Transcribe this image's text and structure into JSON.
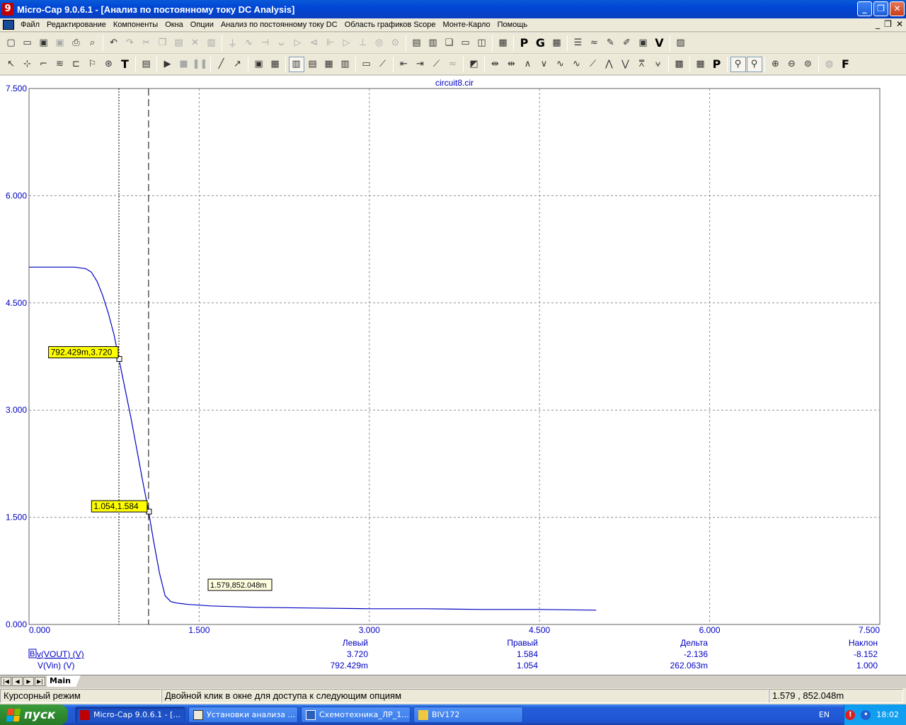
{
  "window": {
    "title": "Micro-Cap 9.0.6.1 - [Анализ по постоянному току DC Analysis]",
    "app_icon_glyph": "9",
    "controls": [
      "_",
      "❐",
      "✕"
    ]
  },
  "menu": {
    "items": [
      "Файл",
      "Редактирование",
      "Компоненты",
      "Окна",
      "Опции",
      "Анализ по постоянному току DC",
      "Область графиков Scope",
      "Монте-Карло",
      "Помощь"
    ],
    "mdi_controls": [
      "_",
      "❐",
      "✕"
    ]
  },
  "toolbar1": [
    "new-icon",
    "open-icon",
    "save-icon",
    "save-all-icon",
    "print-icon",
    "print-preview-icon",
    "sep",
    "undo-icon",
    "redo-icon",
    "cut-icon",
    "copy-icon",
    "paste-icon",
    "delete-icon",
    "select-all-icon",
    "sep",
    "ground-icon",
    "resistor-icon",
    "capacitor-icon",
    "inductor-icon",
    "diode-icon",
    "bjt-icon",
    "mosfet-icon",
    "opamp-icon",
    "battery-icon",
    "source-icon",
    "sine-source-icon",
    "sep",
    "tile-horizontal-icon",
    "tile-vertical-icon",
    "cascade-icon",
    "window-icon",
    "split-icon",
    "sep",
    "calculator-icon",
    "sep",
    "p-icon",
    "g-icon",
    "grid-icon",
    "sep",
    "list-icon",
    "wave-icon",
    "probe-icon",
    "pen-icon",
    "scope-icon",
    "vd-icon",
    "sep",
    "picture-icon"
  ],
  "toolbar2": [
    "select-arrow-icon",
    "component-icon",
    "wire-icon",
    "bus-icon",
    "node-icon",
    "flag-icon",
    "point-icon",
    "text-icon",
    "sep",
    "properties-icon",
    "sep",
    "run-icon",
    "stop-icon",
    "pause-icon",
    "sep",
    "line-icon",
    "diagonal-icon",
    "sep",
    "box-icon",
    "table-icon",
    "sep",
    "grid1-icon",
    "grid2-icon",
    "grid3-icon",
    "grid4-icon",
    "sep",
    "scale-icon",
    "tangent-icon",
    "sep",
    "peak-left-icon",
    "peak-right-icon",
    "slope-icon",
    "flat-icon",
    "sep",
    "chart-icon",
    "sep",
    "cursor-left-icon",
    "cursor-right-icon",
    "peak-icon",
    "valley-icon",
    "high-icon",
    "low-icon",
    "inflection-icon",
    "global-high-icon",
    "global-low-icon",
    "top-icon",
    "bottom-icon",
    "sep",
    "package-icon",
    "sep",
    "numeric-icon",
    "p-tag-icon",
    "sep",
    "cursor-mode-icon",
    "cursor-mode2-icon",
    "sep",
    "zoom-in-icon",
    "zoom-out-icon",
    "zoom-fit-icon",
    "sep",
    "stepping-icon",
    "f-icon"
  ],
  "plot": {
    "file_title": "circuit8.cir",
    "callouts": {
      "left_cursor": "792.429m,3.720",
      "right_cursor": "1.054,1.584",
      "mouse": "1.579,852.048m"
    }
  },
  "chart_data": {
    "type": "line",
    "title": "circuit8.cir",
    "xlim": [
      0,
      7.5
    ],
    "ylim": [
      0,
      7.5
    ],
    "x_ticks": [
      "0.000",
      "1.500",
      "3.000",
      "4.500",
      "6.000",
      "7.500"
    ],
    "y_ticks": [
      "0.000",
      "1.500",
      "3.000",
      "4.500",
      "6.000",
      "7.500"
    ],
    "grid": true,
    "series": [
      {
        "name": "v(VOUT) (V)",
        "color": "#0000c0",
        "x": [
          0,
          0.2,
          0.4,
          0.5,
          0.55,
          0.6,
          0.65,
          0.7,
          0.75,
          0.792,
          0.85,
          0.9,
          0.95,
          1.0,
          1.054,
          1.1,
          1.15,
          1.2,
          1.25,
          1.3,
          1.4,
          1.5,
          1.6,
          1.8,
          2.0,
          2.5,
          3.0,
          3.5,
          4.0,
          4.5,
          5.0
        ],
        "y": [
          5.0,
          5.0,
          5.0,
          4.98,
          4.93,
          4.8,
          4.6,
          4.35,
          4.05,
          3.72,
          3.27,
          2.88,
          2.45,
          2.02,
          1.584,
          1.15,
          0.72,
          0.4,
          0.32,
          0.3,
          0.28,
          0.27,
          0.26,
          0.25,
          0.24,
          0.23,
          0.22,
          0.22,
          0.21,
          0.21,
          0.2
        ]
      }
    ],
    "cursors": {
      "left": {
        "x": 0.792429,
        "y": 3.72
      },
      "right": {
        "x": 1.054,
        "y": 1.584
      },
      "mouse": {
        "x": 1.579,
        "y": 0.852048
      }
    }
  },
  "readout": {
    "headers": [
      "Левый",
      "Правый",
      "Дельта",
      "Наклон"
    ],
    "rows": [
      {
        "prefix": "B",
        "label": "v(VOUT) (V)",
        "values": [
          "3.720",
          "1.584",
          "-2.136",
          "-8.152"
        ]
      },
      {
        "prefix": "",
        "label": "V(Vin) (V)",
        "values": [
          "792.429m",
          "1.054",
          "262.063m",
          "1.000"
        ]
      }
    ]
  },
  "tabs": {
    "nav": [
      "|◀",
      "◀",
      "▶",
      "▶|"
    ],
    "main": "Main"
  },
  "status": {
    "mode": "Курсорный режим",
    "hint": "Двойной клик в окне для доступа к следующим опциям",
    "coords": "1.579 , 852.048m"
  },
  "taskbar": {
    "start": "пуск",
    "tasks": [
      {
        "label": "Micro-Cap 9.0.6.1 - [...",
        "icon": "microcap-icon",
        "active": true
      },
      {
        "label": "Установки анализа ...",
        "icon": "dialog-icon",
        "active": false
      },
      {
        "label": "Схемотехника_ЛР_1...",
        "icon": "word-icon",
        "active": false
      },
      {
        "label": "BIV172",
        "icon": "folder-icon",
        "active": false
      }
    ],
    "lang": "EN",
    "clock": "18:02"
  },
  "colors": {
    "curve": "#0000c0",
    "axis_text": "#0000c0",
    "callout_yellow": "#ffff00",
    "titlebar": "#0046d5"
  }
}
